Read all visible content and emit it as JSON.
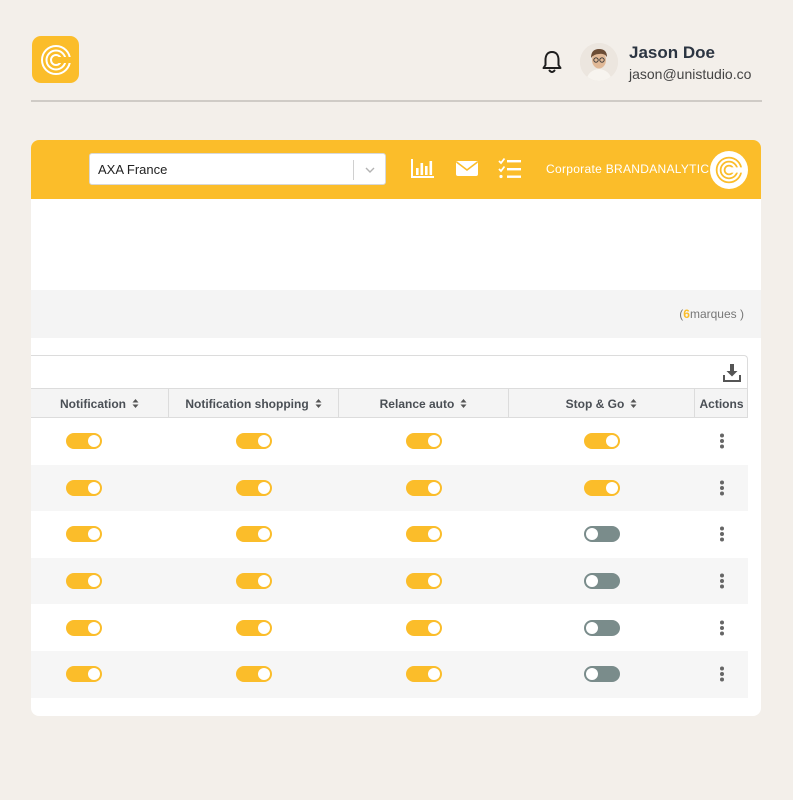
{
  "header": {
    "user_name": "Jason Doe",
    "user_email": "jason@unistudio.co",
    "brand_color": "#fbbd2a"
  },
  "toolbar": {
    "company": "AXA France",
    "brand_label": "Corporate BRANDANALYTIC",
    "icons": [
      "chart-icon",
      "mail-icon",
      "checklist-icon"
    ]
  },
  "summary": {
    "count_open": "(",
    "count": "6",
    "count_label": "marques )"
  },
  "table": {
    "columns": [
      "Notification",
      "Notification shopping",
      "Relance auto",
      "Stop & Go",
      "Actions"
    ],
    "rows": [
      {
        "notification": true,
        "notification_shopping": true,
        "relance_auto": true,
        "stop_go": true
      },
      {
        "notification": true,
        "notification_shopping": true,
        "relance_auto": true,
        "stop_go": true
      },
      {
        "notification": true,
        "notification_shopping": true,
        "relance_auto": true,
        "stop_go": false
      },
      {
        "notification": true,
        "notification_shopping": true,
        "relance_auto": true,
        "stop_go": false
      },
      {
        "notification": true,
        "notification_shopping": true,
        "relance_auto": true,
        "stop_go": false
      },
      {
        "notification": true,
        "notification_shopping": true,
        "relance_auto": true,
        "stop_go": false
      }
    ],
    "toggle_on_color": "#fbbd2a",
    "toggle_off_color": "#7a8c8b"
  }
}
